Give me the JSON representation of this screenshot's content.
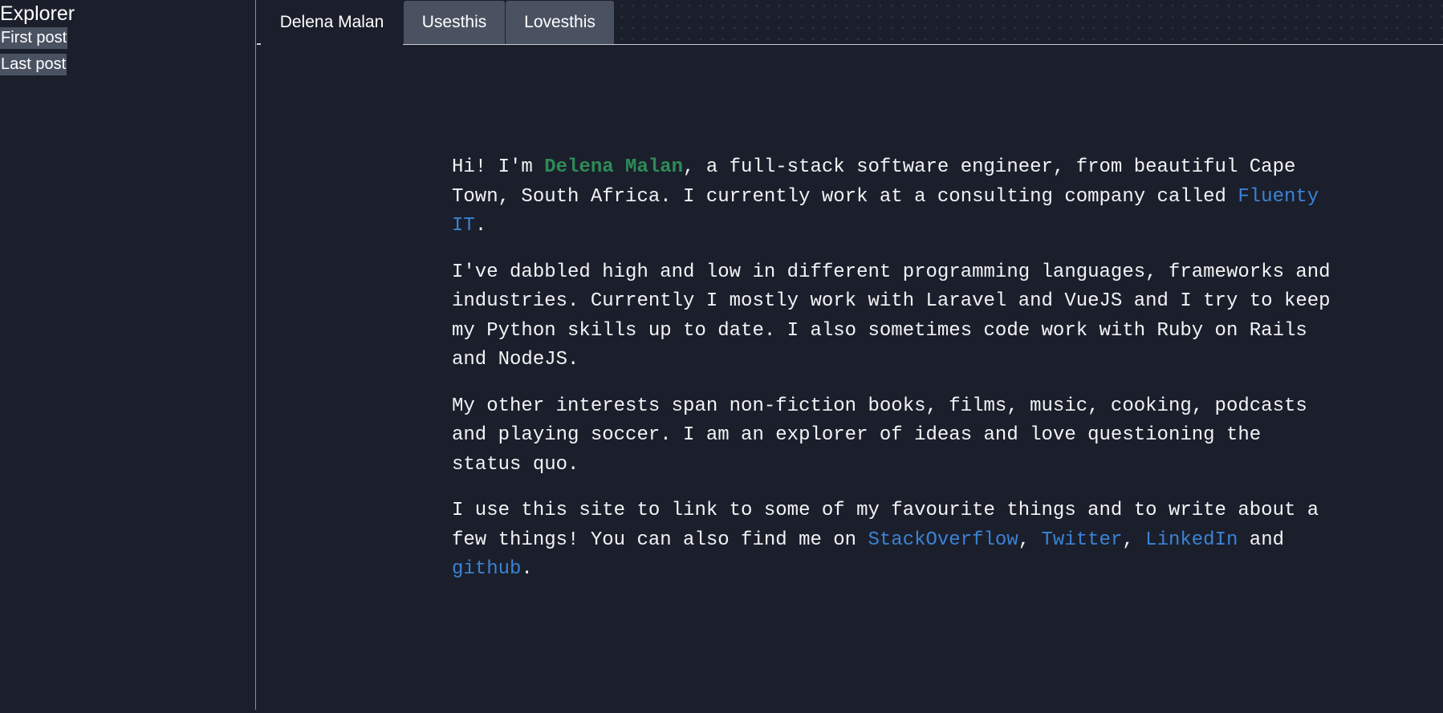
{
  "sidebar": {
    "title": "Explorer",
    "links": [
      "First post",
      "Last post"
    ]
  },
  "tabs": [
    {
      "label": "Delena Malan",
      "active": true
    },
    {
      "label": "Usesthis",
      "active": false
    },
    {
      "label": "Lovesthis",
      "active": false
    }
  ],
  "content": {
    "p1": {
      "pre": "Hi! I'm ",
      "name": "Delena Malan",
      "mid": ", a full-stack software engineer, from beautiful Cape Town, South Africa. I currently work at a consulting company called ",
      "company_link": "Fluenty IT",
      "post": "."
    },
    "p2": "I've dabbled high and low in different programming languages, frameworks and industries. Currently I mostly work with Laravel and VueJS and I try to keep my Python skills up to date. I also sometimes code work with Ruby on Rails and NodeJS.",
    "p3": "My other interests span non-fiction books, films, music, cooking, podcasts and playing soccer. I am an explorer of ideas and love questioning the status quo.",
    "p4": {
      "pre": "I use this site to link to some of my favourite things and to write about a few things! You can also find me on ",
      "link_stackoverflow": "StackOverflow",
      "sep1": ", ",
      "link_twitter": "Twitter",
      "sep2": ", ",
      "link_linkedin": "LinkedIn",
      "sep3": " and ",
      "link_github": "github",
      "post": "."
    }
  },
  "colors": {
    "background": "#1b1f2b",
    "tab_inactive": "#4a5262",
    "name_highlight": "#2e8b57",
    "link": "#3b82d6"
  }
}
